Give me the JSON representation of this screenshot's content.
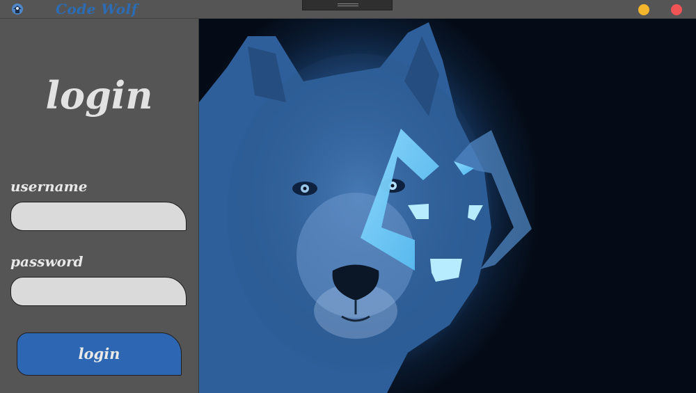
{
  "window": {
    "title": "Code Wolf",
    "logo_icon": "wolf-logo-icon",
    "controls": {
      "minimize_color": "#f3b62d",
      "close_color": "#f05454"
    }
  },
  "form": {
    "heading": "login",
    "username_label": "username",
    "username_value": "",
    "password_label": "password",
    "password_value": "",
    "submit_label": "login"
  },
  "colors": {
    "panel": "#555555",
    "accent": "#2d67b3",
    "field": "#dadada",
    "text": "#e2e2e2"
  },
  "hero": {
    "subject": "wolf-photo",
    "logo": "code-wolf-logo"
  }
}
